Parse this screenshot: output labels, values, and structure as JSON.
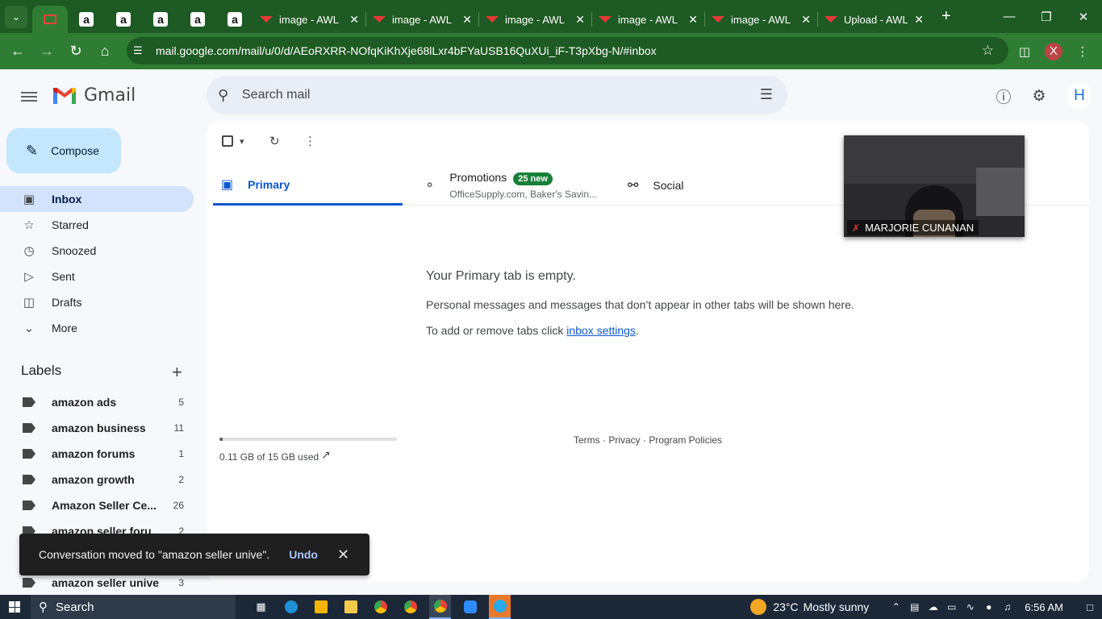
{
  "browser": {
    "tabs": [
      {
        "type": "gmail",
        "title": "",
        "active": true
      },
      {
        "type": "amazon",
        "title": ""
      },
      {
        "type": "amazon",
        "title": ""
      },
      {
        "type": "amazon",
        "title": ""
      },
      {
        "type": "amazon",
        "title": ""
      },
      {
        "type": "amazon",
        "title": ""
      },
      {
        "type": "awl",
        "title": "image - AWL"
      },
      {
        "type": "awl",
        "title": "image - AWL"
      },
      {
        "type": "awl",
        "title": "image - AWL"
      },
      {
        "type": "awl",
        "title": "image - AWL"
      },
      {
        "type": "awl",
        "title": "image - AWL"
      },
      {
        "type": "awl",
        "title": "Upload - AWL"
      }
    ],
    "url": "mail.google.com/mail/u/0/d/AEoRXRR-NOfqKiKhXje68lLxr4bFYaUSB16QuXUi_iF-T3pXbg-N/#inbox",
    "profile_initial": "X",
    "theme_color": "#2f7d34"
  },
  "gmail": {
    "logo_text": "Gmail",
    "search_placeholder": "Search mail",
    "account_initial": "H",
    "compose_label": "Compose",
    "nav": [
      {
        "label": "Inbox",
        "icon": "inbox-icon",
        "active": true
      },
      {
        "label": "Starred",
        "icon": "star-icon"
      },
      {
        "label": "Snoozed",
        "icon": "clock-icon"
      },
      {
        "label": "Sent",
        "icon": "send-icon"
      },
      {
        "label": "Drafts",
        "icon": "draft-icon"
      },
      {
        "label": "More",
        "icon": "chevron-down-icon"
      }
    ],
    "labels_heading": "Labels",
    "labels": [
      {
        "name": "amazon ads",
        "count": "5"
      },
      {
        "name": "amazon business",
        "count": "11"
      },
      {
        "name": "amazon forums",
        "count": "1"
      },
      {
        "name": "amazon growth",
        "count": "2"
      },
      {
        "name": "Amazon Seller Ce...",
        "count": "26"
      },
      {
        "name": "amazon seller foru...",
        "count": "2"
      },
      {
        "name": "",
        "count": ""
      },
      {
        "name": "amazon seller unive",
        "count": "3"
      }
    ],
    "tabs": {
      "primary": "Primary",
      "promotions": "Promotions",
      "promotions_badge": "25 new",
      "promotions_senders": "OfficeSupply.com, Baker's Savin...",
      "social": "Social"
    },
    "empty": {
      "title": "Your Primary tab is empty.",
      "description": "Personal messages and messages that don’t appear in other tabs will be shown here.",
      "hint_prefix": "To add or remove tabs click ",
      "hint_link": "inbox settings",
      "hint_suffix": "."
    },
    "storage": {
      "text": "0.11 GB of 15 GB used",
      "used_fraction": 0.0073
    },
    "footer": "Terms · Privacy · Program Policies",
    "snackbar": {
      "message": "Conversation moved to \"amazon seller unive\".",
      "action": "Undo"
    }
  },
  "video_overlay": {
    "name": "MARJORIE CUNANAN"
  },
  "taskbar": {
    "search_label": "Search",
    "weather_temp": "23°C",
    "weather_text": "Mostly sunny",
    "time": "6:56 AM"
  }
}
